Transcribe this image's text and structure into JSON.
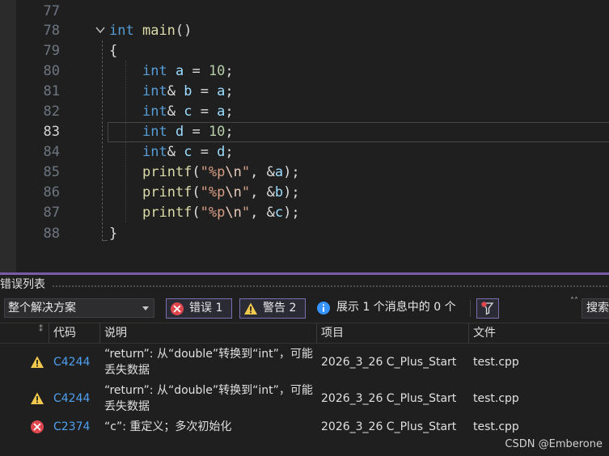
{
  "editor": {
    "current_line": "83",
    "lines": [
      {
        "num": "77"
      },
      {
        "num": "78",
        "t1": "int",
        "t2": " ",
        "t3": "main",
        "t4": "()"
      },
      {
        "num": "79",
        "t1": "{"
      },
      {
        "num": "80",
        "t1": "int",
        "t2": " ",
        "t3": "a",
        "t4": " = ",
        "t5": "10",
        "t6": ";"
      },
      {
        "num": "81",
        "t1": "int",
        "t2": "& ",
        "t3": "b",
        "t4": " = ",
        "t5": "a",
        "t6": ";"
      },
      {
        "num": "82",
        "t1": "int",
        "t2": "& ",
        "t3": "c",
        "t4": " = ",
        "t5": "a",
        "t6": ";"
      },
      {
        "num": "83",
        "t1": "int",
        "t2": " ",
        "t3": "d",
        "t4": " = ",
        "t5": "10",
        "t6": ";"
      },
      {
        "num": "84",
        "t1": "int",
        "t2": "& ",
        "t3": "c",
        "t4": " = ",
        "t5": "d",
        "t6": ";"
      },
      {
        "num": "85",
        "t1": "printf",
        "t2": "(",
        "t3": "\"%p",
        "t4": "\\n",
        "t5": "\"",
        "t6": ", &",
        "t7": "a",
        "t8": ");"
      },
      {
        "num": "86",
        "t1": "printf",
        "t2": "(",
        "t3": "\"%p",
        "t4": "\\n",
        "t5": "\"",
        "t6": ", &",
        "t7": "b",
        "t8": ");"
      },
      {
        "num": "87",
        "t1": "printf",
        "t2": "(",
        "t3": "\"%p",
        "t4": "\\n",
        "t5": "\"",
        "t6": ", &",
        "t7": "c",
        "t8": ");"
      },
      {
        "num": "88",
        "t1": "}"
      }
    ]
  },
  "error_list": {
    "title": "错误列表",
    "scope": "整个解决方案",
    "errors_label": "错误 1",
    "warnings_label": "警告 2",
    "messages_label": "展示 1 个消息中的 0 个",
    "search_label": "搜索",
    "overflow": "˄˄",
    "columns": {
      "code": "代码",
      "description": "说明",
      "project": "项目",
      "file": "文件"
    },
    "rows": [
      {
        "severity": "warning-icon",
        "code": "C4244",
        "description": "“return”: 从“double”转换到“int”，可能丢失数据",
        "project": "2026_3_26 C_Plus_Start",
        "file": "test.cpp"
      },
      {
        "severity": "warning-icon",
        "code": "C4244",
        "description": "“return”: 从“double”转换到“int”，可能丢失数据",
        "project": "2026_3_26 C_Plus_Start",
        "file": "test.cpp"
      },
      {
        "severity": "error-icon",
        "code": "C2374",
        "description": "“c”: 重定义；多次初始化",
        "project": "2026_3_26 C_Plus_Start",
        "file": "test.cpp"
      }
    ]
  },
  "watermark": "CSDN @Emberone",
  "colors": {
    "accent": "#7b5aa6",
    "error": "#e0464e",
    "warning": "#f2c94c",
    "info": "#3794ff",
    "link": "#4fa0f0"
  }
}
